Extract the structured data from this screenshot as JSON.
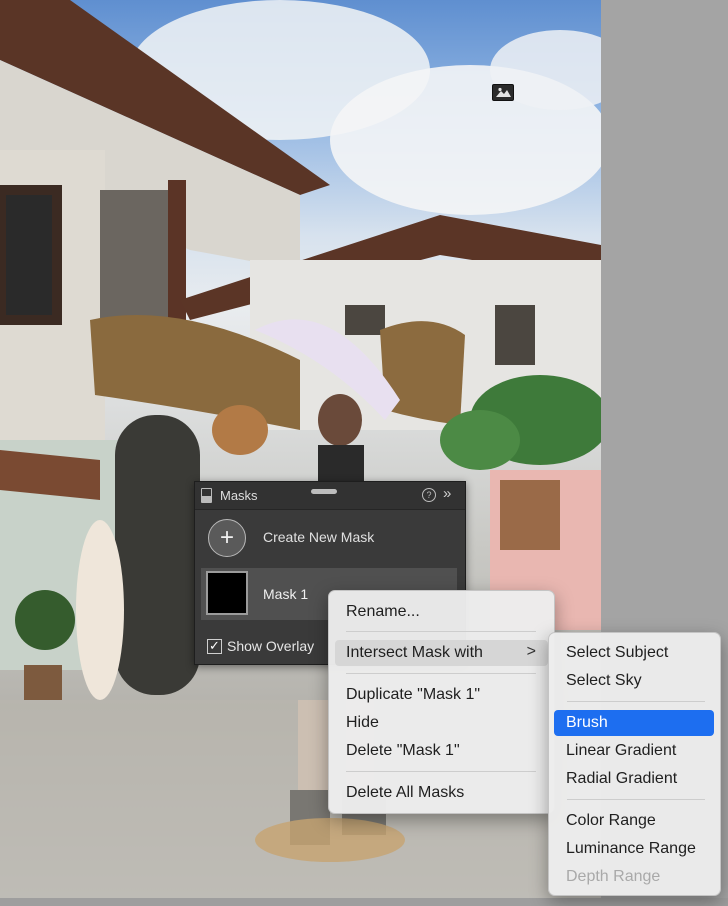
{
  "masks_panel": {
    "title": "Masks",
    "help_icon": "?",
    "collapse_icon": "»",
    "create_icon": "+",
    "create_label": "Create New Mask",
    "mask_name": "Mask 1",
    "overlay_check": "✓",
    "show_overlay_label": "Show Overlay"
  },
  "context_menu": {
    "rename": "Rename...",
    "intersect": "Intersect Mask with",
    "submenu_arrow": ">",
    "duplicate": "Duplicate \"Mask 1\"",
    "hide": "Hide",
    "delete": "Delete \"Mask 1\"",
    "delete_all": "Delete All Masks"
  },
  "submenu": {
    "select_subject": "Select Subject",
    "select_sky": "Select Sky",
    "brush": "Brush",
    "linear_gradient": "Linear Gradient",
    "radial_gradient": "Radial Gradient",
    "color_range": "Color Range",
    "luminance_range": "Luminance Range",
    "depth_range": "Depth Range"
  },
  "colors": {
    "selection_blue": "#1d6ef0",
    "panel_bg": "#3a3a3a",
    "menu_bg": "#ececec"
  }
}
